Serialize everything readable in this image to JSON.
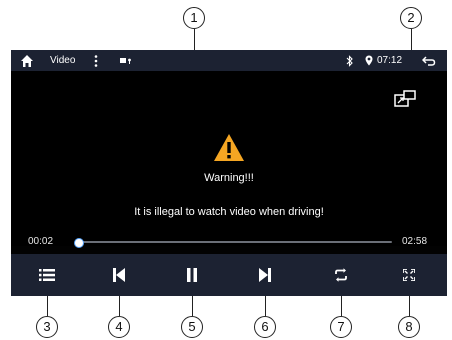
{
  "status_bar": {
    "home_icon": "home-icon",
    "title": "Video",
    "menu_icon": "more-vertical-icon",
    "source_icon": "video-source-icon",
    "bluetooth_icon": "bluetooth-icon",
    "location_icon": "location-pin-icon",
    "time": "07:12",
    "back_icon": "back-arrow-icon"
  },
  "overlay": {
    "warning_icon": "warning-triangle-icon",
    "warning_title": "Warning!!!",
    "warning_message": "It is illegal to watch video when driving!",
    "pip_icon": "picture-in-picture-icon"
  },
  "progress": {
    "current_time": "00:02",
    "total_time": "02:58",
    "fraction": 0.011
  },
  "controls": [
    {
      "name": "playlist-button",
      "icon": "list-icon"
    },
    {
      "name": "previous-button",
      "icon": "skip-previous-icon"
    },
    {
      "name": "pause-button",
      "icon": "pause-icon"
    },
    {
      "name": "next-button",
      "icon": "skip-next-icon"
    },
    {
      "name": "repeat-button",
      "icon": "repeat-icon"
    },
    {
      "name": "fullscreen-button",
      "icon": "fullscreen-icon"
    }
  ],
  "callouts": [
    "1",
    "2",
    "3",
    "4",
    "5",
    "6",
    "7",
    "8"
  ],
  "colors": {
    "bar_background": "#1c2232",
    "screen_background": "#000000",
    "warning_yellow": "#f5a623",
    "accent_blue": "#5aa7ff"
  }
}
